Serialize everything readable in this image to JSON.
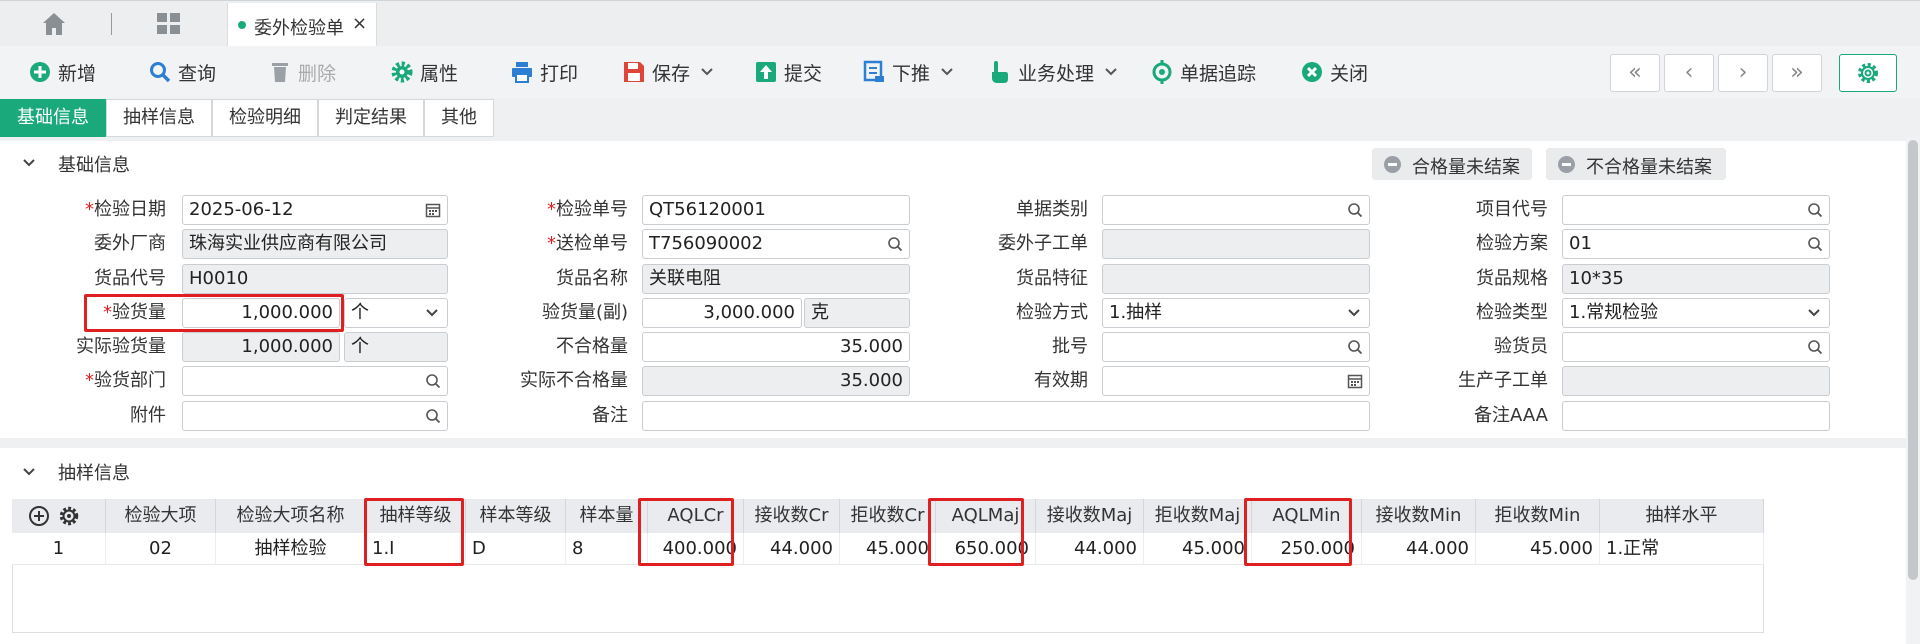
{
  "colors": {
    "accent": "#19a97b",
    "highlight": "#e02020",
    "required": "#e02020"
  },
  "tabbar": {
    "tab_label": "委外检验单",
    "close_glyph": "×"
  },
  "toolbar": {
    "new": "新增",
    "query": "查询",
    "delete": "删除",
    "properties": "属性",
    "print": "打印",
    "save": "保存",
    "submit": "提交",
    "push_down": "下推",
    "business": "业务处理",
    "trace": "单据追踪",
    "close": "关闭",
    "nav_first": "«",
    "nav_prev": "‹",
    "nav_next": "›",
    "nav_last": "»"
  },
  "subtabs": [
    "基础信息",
    "抽样信息",
    "检验明细",
    "判定结果",
    "其他"
  ],
  "section_basic": {
    "title": "基础信息",
    "pill_ok": "合格量未结案",
    "pill_ng": "不合格量未结案"
  },
  "form": {
    "req_mark": "*",
    "inspect_date": {
      "label": "检验日期",
      "value": "2025-06-12"
    },
    "vendor": {
      "label": "委外厂商",
      "value": "珠海实业供应商有限公司"
    },
    "item_code": {
      "label": "货品代号",
      "value": "H0010"
    },
    "inspect_qty": {
      "label": "验货量",
      "value": "1,000.000",
      "unit": "个"
    },
    "actual_qty": {
      "label": "实际验货量",
      "value": "1,000.000",
      "unit": "个"
    },
    "dept": {
      "label": "验货部门",
      "value": ""
    },
    "attachment": {
      "label": "附件",
      "value": ""
    },
    "inspect_no": {
      "label": "检验单号",
      "value": "QT56120001"
    },
    "send_no": {
      "label": "送检单号",
      "value": "T756090002"
    },
    "item_name": {
      "label": "货品名称",
      "value": "关联电阻"
    },
    "inspect_qty_sub": {
      "label": "验货量(副)",
      "value": "3,000.000",
      "unit": "克"
    },
    "ng_qty": {
      "label": "不合格量",
      "value": "35.000"
    },
    "actual_ng_qty": {
      "label": "实际不合格量",
      "value": "35.000"
    },
    "remark": {
      "label": "备注",
      "value": ""
    },
    "doc_type": {
      "label": "单据类别",
      "value": ""
    },
    "sub_work_order": {
      "label": "委外子工单",
      "value": ""
    },
    "item_feature": {
      "label": "货品特征",
      "value": ""
    },
    "inspect_method": {
      "label": "检验方式",
      "value": "1.抽样"
    },
    "batch_no": {
      "label": "批号",
      "value": ""
    },
    "expiry": {
      "label": "有效期",
      "value": ""
    },
    "project_code": {
      "label": "项目代号",
      "value": ""
    },
    "scheme": {
      "label": "检验方案",
      "value": "01"
    },
    "spec": {
      "label": "货品规格",
      "value": "10*35"
    },
    "inspect_type": {
      "label": "检验类型",
      "value": "1.常规检验"
    },
    "inspector": {
      "label": "验货员",
      "value": ""
    },
    "prod_work_order": {
      "label": "生产子工单",
      "value": ""
    },
    "remark_aaa": {
      "label": "备注AAA",
      "value": ""
    }
  },
  "section_sampling": {
    "title": "抽样信息"
  },
  "grid": {
    "columns": [
      "检验大项",
      "检验大项名称",
      "抽样等级",
      "样本等级",
      "样本量",
      "AQLCr",
      "接收数Cr",
      "拒收数Cr",
      "AQLMaj",
      "接收数Maj",
      "拒收数Maj",
      "AQLMin",
      "接收数Min",
      "拒收数Min",
      "抽样水平"
    ],
    "rows": [
      {
        "no": "1",
        "item": "02",
        "item_name": "抽样检验",
        "sample_grade": "1.I",
        "sample_level": "D",
        "sample_size": "8",
        "aql_cr": "400.000",
        "acc_cr": "44.000",
        "rej_cr": "45.000",
        "aql_maj": "650.000",
        "acc_maj": "44.000",
        "rej_maj": "45.000",
        "aql_min": "250.000",
        "acc_min": "44.000",
        "rej_min": "45.000",
        "level": "1.正常"
      }
    ]
  }
}
